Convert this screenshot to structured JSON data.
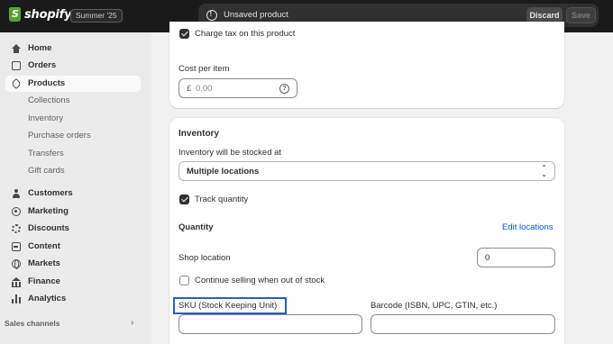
{
  "topbar": {
    "brand": "shopify",
    "edition": "Summer '25",
    "save_bar": {
      "message": "Unsaved product",
      "discard_label": "Discard",
      "save_label": "Save"
    }
  },
  "sidebar": {
    "items": [
      {
        "label": "Home",
        "icon": "home-icon"
      },
      {
        "label": "Orders",
        "icon": "orders-icon"
      },
      {
        "label": "Products",
        "icon": "tag-icon",
        "active": true
      }
    ],
    "sub_items": [
      "Collections",
      "Inventory",
      "Purchase orders",
      "Transfers",
      "Gift cards"
    ],
    "items2": [
      {
        "label": "Customers",
        "icon": "person-icon"
      },
      {
        "label": "Marketing",
        "icon": "target-icon"
      },
      {
        "label": "Discounts",
        "icon": "discount-icon"
      },
      {
        "label": "Content",
        "icon": "content-icon"
      },
      {
        "label": "Markets",
        "icon": "globe-icon"
      },
      {
        "label": "Finance",
        "icon": "bank-icon"
      },
      {
        "label": "Analytics",
        "icon": "bar-chart-icon"
      }
    ],
    "sales_channels": "Sales channels"
  },
  "pricing": {
    "charge_tax_label": "Charge tax on this product",
    "charge_tax_checked": true,
    "cost_per_item_label": "Cost per item",
    "currency_prefix": "£",
    "cost_placeholder": "0.00"
  },
  "inventory": {
    "title": "Inventory",
    "stocked_at_label": "Inventory will be stocked at",
    "stocked_at_value": "Multiple locations",
    "track_quantity_label": "Track quantity",
    "track_quantity_checked": true,
    "quantity_title": "Quantity",
    "edit_locations_link": "Edit locations",
    "shop_location_label": "Shop location",
    "shop_location_value": "0",
    "continue_selling_label": "Continue selling when out of stock",
    "continue_selling_checked": false,
    "sku_label": "SKU (Stock Keeping Unit)",
    "barcode_label": "Barcode (ISBN, UPC, GTIN, etc.)"
  },
  "colors": {
    "link": "#005bd3",
    "highlight": "#2a5bd7",
    "topbar": "#1a1a1a"
  }
}
